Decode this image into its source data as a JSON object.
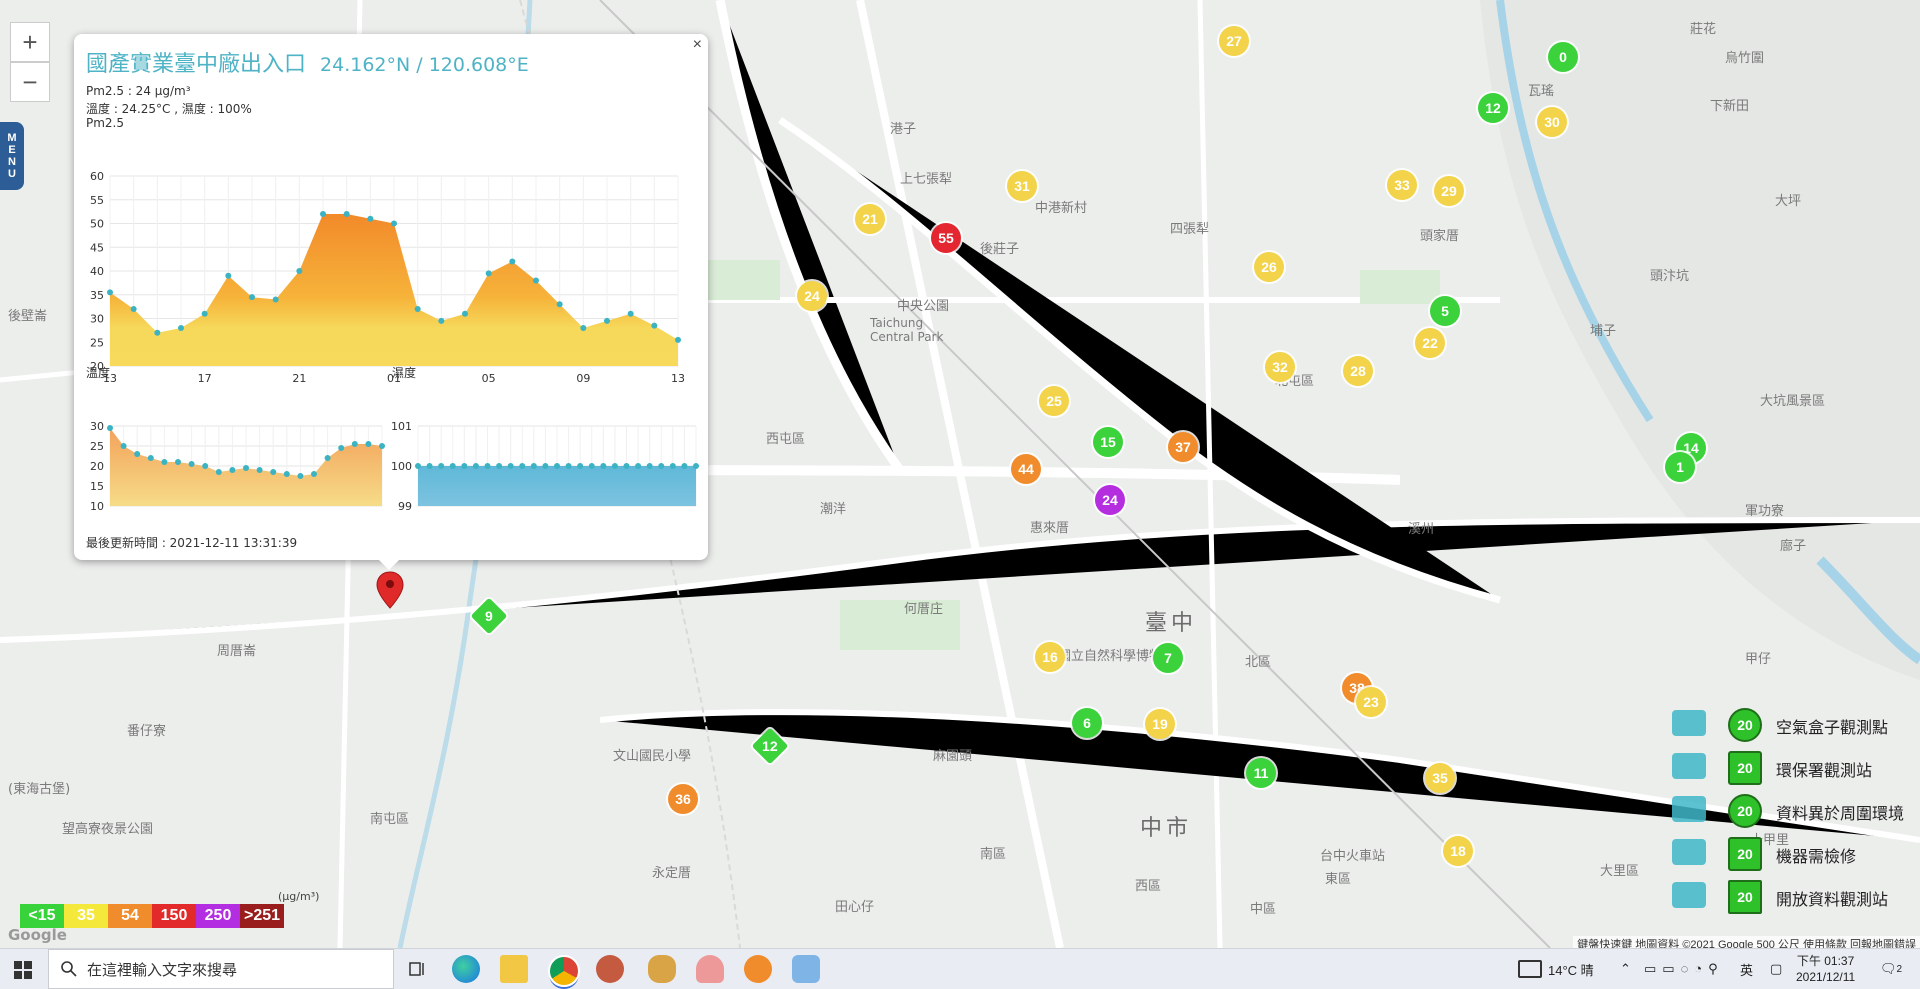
{
  "map": {
    "zoom_in": "+",
    "zoom_out": "−",
    "menu_letters": [
      "M",
      "E",
      "N",
      "U"
    ],
    "places": [
      {
        "t": "臺中",
        "big": true
      },
      {
        "t": "中市",
        "big": true
      },
      {
        "t": "港子"
      },
      {
        "t": "上七張犁"
      },
      {
        "t": "四張犁"
      },
      {
        "t": "頭家厝"
      },
      {
        "t": "北屯區"
      },
      {
        "t": "西屯區"
      },
      {
        "t": "西區"
      },
      {
        "t": "南屯區"
      },
      {
        "t": "中港新村"
      },
      {
        "t": "後莊子"
      },
      {
        "t": "中央公園"
      },
      {
        "t": "Taichung Central Park"
      },
      {
        "t": "潮洋"
      },
      {
        "t": "惠來厝"
      },
      {
        "t": "何厝庄"
      },
      {
        "t": "麻園頭"
      },
      {
        "t": "東區"
      },
      {
        "t": "南區"
      },
      {
        "t": "北區"
      },
      {
        "t": "中區"
      },
      {
        "t": "大坑風景區"
      },
      {
        "t": "瓦瑤"
      },
      {
        "t": "莊花"
      },
      {
        "t": "烏竹圍"
      },
      {
        "t": "下新田"
      },
      {
        "t": "大坪"
      },
      {
        "t": "甲仔"
      },
      {
        "t": "周厝崙"
      },
      {
        "t": "溪州"
      },
      {
        "t": "田心仔"
      },
      {
        "t": "永定厝"
      },
      {
        "t": "十甲里"
      },
      {
        "t": "軍功寮"
      },
      {
        "t": "廍子"
      },
      {
        "t": "大里區"
      },
      {
        "t": "頭汴坑"
      },
      {
        "t": "埔子"
      },
      {
        "t": "後壁崙"
      },
      {
        "t": "番仔寮"
      },
      {
        "t": "國立自然科學博物館"
      },
      {
        "t": "台中火車站"
      },
      {
        "t": "文山國民小學"
      },
      {
        "t": "望高寮夜景公園"
      },
      {
        "t": "(東海古堡)"
      },
      {
        "t": "中央公園",
        "dup": true
      }
    ],
    "markers": [
      {
        "v": "55",
        "c": "red"
      },
      {
        "v": "44",
        "c": "orange"
      },
      {
        "v": "37",
        "c": "orange"
      },
      {
        "v": "38",
        "c": "orange"
      },
      {
        "v": "36",
        "c": "orange"
      },
      {
        "v": "24",
        "c": "purple"
      },
      {
        "v": "0",
        "c": "green"
      },
      {
        "v": "12",
        "c": "green"
      },
      {
        "v": "15",
        "c": "green"
      },
      {
        "v": "5",
        "c": "green"
      },
      {
        "v": "6",
        "c": "green"
      },
      {
        "v": "7",
        "c": "green"
      },
      {
        "v": "11",
        "c": "green"
      },
      {
        "v": "14",
        "c": "green"
      },
      {
        "v": "1",
        "c": "green"
      },
      {
        "v": "9",
        "c": "green",
        "dia": true
      },
      {
        "v": "12",
        "c": "green",
        "dia": true
      },
      {
        "v": "27",
        "c": "yellow"
      },
      {
        "v": "30",
        "c": "yellow"
      },
      {
        "v": "21",
        "c": "yellow"
      },
      {
        "v": "31",
        "c": "yellow"
      },
      {
        "v": "33",
        "c": "yellow"
      },
      {
        "v": "29",
        "c": "yellow"
      },
      {
        "v": "26",
        "c": "yellow"
      },
      {
        "v": "25",
        "c": "yellow"
      },
      {
        "v": "28",
        "c": "yellow"
      },
      {
        "v": "32",
        "c": "yellow"
      },
      {
        "v": "24",
        "c": "yellow"
      },
      {
        "v": "22",
        "c": "yellow"
      },
      {
        "v": "23",
        "c": "yellow"
      },
      {
        "v": "19",
        "c": "yellow"
      },
      {
        "v": "16",
        "c": "yellow"
      },
      {
        "v": "35",
        "c": "yellow"
      },
      {
        "v": "18",
        "c": "yellow"
      }
    ]
  },
  "popup": {
    "title": "國產實業臺中廠出入口",
    "coord": "24.162°N / 120.608°E",
    "close": "×",
    "pm_line": "Pm2.5 : 24 µg/m³",
    "temp_line": "溫度 : 24.25°C , 濕度 : 100%",
    "chart_title": "Pm2.5",
    "temp_title": "溫度",
    "hum_title": "濕度",
    "updated": "最後更新時間 : 2021-12-11 13:31:39"
  },
  "chart_data": [
    {
      "type": "area",
      "title": "Pm2.5",
      "x_ticks": [
        "13",
        "17",
        "21",
        "01",
        "05",
        "09",
        "13"
      ],
      "y_ticks": [
        20,
        25,
        30,
        35,
        40,
        45,
        50,
        55,
        60
      ],
      "ylim": [
        20,
        60
      ],
      "values": [
        35.5,
        32,
        27,
        28,
        31,
        39,
        34.5,
        34,
        40,
        52,
        52,
        51,
        50,
        32,
        29.5,
        31,
        39.5,
        42,
        38,
        33,
        28,
        29.5,
        31,
        28.5,
        25.5
      ],
      "grid": true
    },
    {
      "type": "area",
      "title": "溫度",
      "y_ticks": [
        10,
        15,
        20,
        25,
        30
      ],
      "ylim": [
        10,
        30
      ],
      "values": [
        29.5,
        25,
        23,
        22,
        21,
        21,
        20.5,
        20,
        18.5,
        19,
        19.5,
        19,
        18.5,
        18,
        17.5,
        18,
        22,
        24.5,
        25.5,
        25.5,
        25
      ],
      "grid": true
    },
    {
      "type": "area",
      "title": "濕度",
      "y_ticks": [
        99,
        100,
        101
      ],
      "ylim": [
        99,
        101
      ],
      "values": [
        100,
        100,
        100,
        100,
        100,
        100,
        100,
        100,
        100,
        100,
        100,
        100,
        100,
        100,
        100,
        100,
        100,
        100,
        100,
        100,
        100,
        100,
        100,
        100,
        100
      ],
      "grid": true
    }
  ],
  "legend": {
    "unit": "(μg/m³)",
    "scale": [
      {
        "label": "<15",
        "color": "#38d33a"
      },
      {
        "label": "35",
        "color": "#f4e83a"
      },
      {
        "label": "54",
        "color": "#f08c2c"
      },
      {
        "label": "150",
        "color": "#e22a2a"
      },
      {
        "label": "250",
        "color": "#b22ee0"
      },
      {
        "label": ">251",
        "color": "#9a1d1d"
      }
    ],
    "types": [
      {
        "num": "20",
        "label": "空氣盒子觀測點"
      },
      {
        "num": "20",
        "label": "環保署觀測站"
      },
      {
        "num": "20",
        "label": "資料異於周圍環境"
      },
      {
        "num": "20",
        "label": "機器需檢修"
      },
      {
        "num": "20",
        "label": "開放資料觀測站"
      }
    ]
  },
  "attribution": {
    "text": "鍵盤快速鍵  地圖資料 ©2021 Google  500 公尺  使用條款  回報地圖錯誤",
    "google": "Google"
  },
  "taskbar": {
    "search_placeholder": "在這裡輸入文字來搜尋",
    "weather": "14°C 晴",
    "ime": "英",
    "time": "下午 01:37",
    "date": "2021/12/11",
    "notif_count": "2"
  },
  "colors": {
    "green": "#3bd23c",
    "yellow": "#f2d34a",
    "orange": "#f08c2c",
    "red": "#e3262f",
    "purple": "#b42ee0",
    "accent": "#4fb3c6"
  }
}
